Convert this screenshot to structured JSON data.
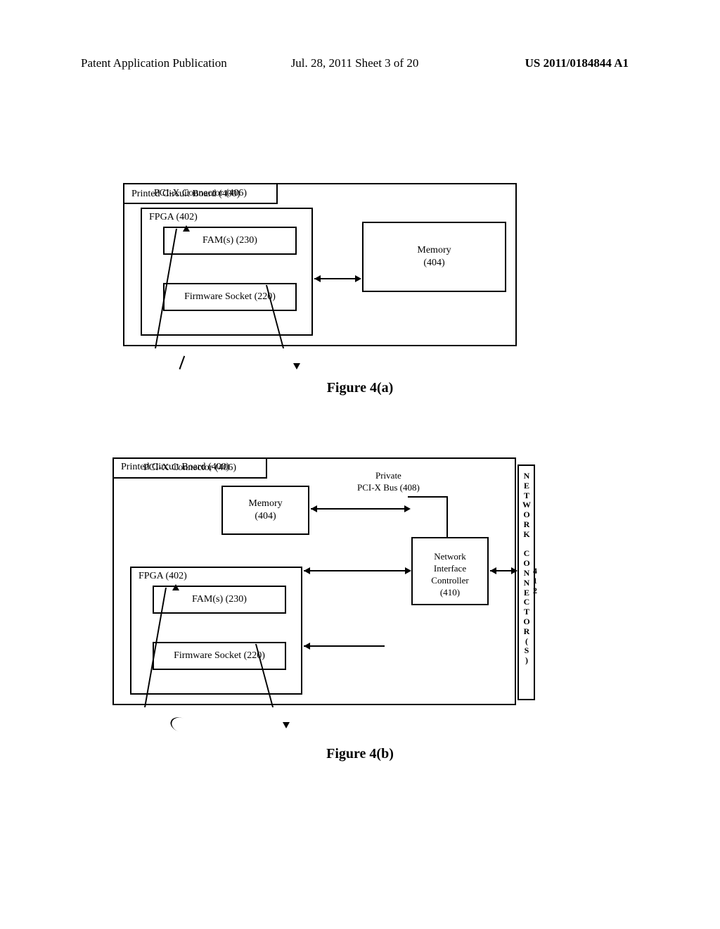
{
  "header": {
    "left": "Patent Application Publication",
    "middle": "Jul. 28, 2011  Sheet 3 of 20",
    "right": "US 2011/0184844 A1"
  },
  "figA": {
    "pcb": "Printed Circuit Board (400)",
    "fpga": "FPGA (402)",
    "fams": "FAM(s) (230)",
    "firmware_socket": "Firmware Socket (220)",
    "memory": "Memory\n(404)",
    "pcix_connector": "PCI-X Connector (406)",
    "caption": "Figure 4(a)"
  },
  "figB": {
    "pcb": "Printed Circuit Board (400)",
    "memory": "Memory\n(404)",
    "fpga": "FPGA (402)",
    "fams": "FAM(s) (230)",
    "firmware_socket": "Firmware Socket (220)",
    "pcix_connector": "PCI-X Connector (406)",
    "bus": "Private\nPCI-X Bus (408)",
    "nic": "Network\nInterface\nController\n(410)",
    "net_connector": "NETWORK CONNECTOR(S)",
    "net_connector_num": "412",
    "caption": "Figure 4(b)"
  }
}
